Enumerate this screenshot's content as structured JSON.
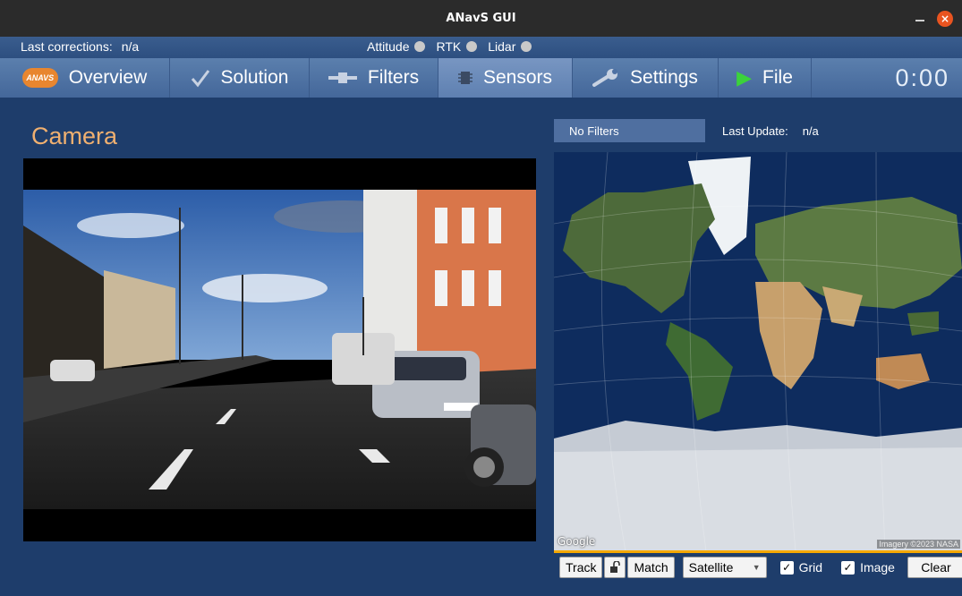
{
  "window": {
    "title": "ANavS GUI"
  },
  "status": {
    "corrections_label": "Last corrections:",
    "corrections_value": "n/a",
    "indicators": [
      {
        "label": "Attitude",
        "state_color": "#c9c9c9"
      },
      {
        "label": "RTK",
        "state_color": "#c9c9c9"
      },
      {
        "label": "Lidar",
        "state_color": "#c9c9c9"
      }
    ]
  },
  "nav": {
    "logo_text": "ANAVS",
    "tabs": [
      {
        "label": "Overview",
        "icon": "anavs-logo-icon"
      },
      {
        "label": "Solution",
        "icon": "checkmark-icon"
      },
      {
        "label": "Filters",
        "icon": "filter-icon"
      },
      {
        "label": "Sensors",
        "icon": "chip-icon",
        "active": true
      },
      {
        "label": "Settings",
        "icon": "wrench-icon"
      },
      {
        "label": "File",
        "icon": "play-icon"
      }
    ],
    "timer": "0:00"
  },
  "camera": {
    "title": "Camera"
  },
  "filters": {
    "label": "No Filters"
  },
  "last_update": {
    "label": "Last Update:",
    "value": "n/a"
  },
  "map": {
    "brand": "Google",
    "credit": "Imagery ©2023 NASA"
  },
  "controls": {
    "track_label": "Track",
    "match_label": "Match",
    "map_type": "Satellite",
    "grid_label": "Grid",
    "grid_checked": true,
    "image_label": "Image",
    "image_checked": true,
    "clear_label": "Clear"
  },
  "colors": {
    "accent": "#f0b070",
    "progress": "#f5a800",
    "play": "#3bd23b"
  }
}
